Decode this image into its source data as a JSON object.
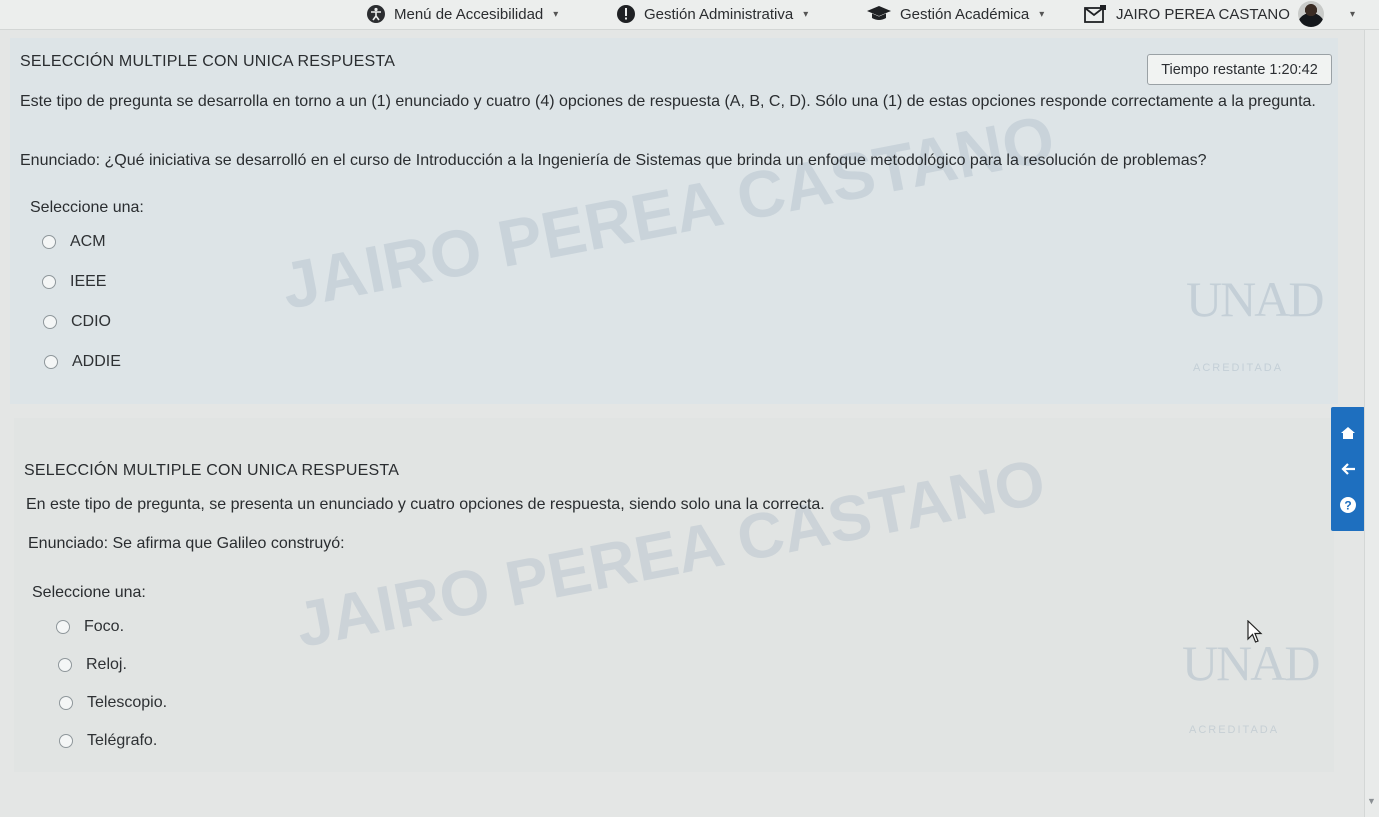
{
  "topbar": {
    "accessibility_menu": "Menú de Accesibilidad",
    "gestion_administrativa": "Gestión Administrativa",
    "gestion_academica": "Gestión Académica",
    "user_name": "JAIRO PEREA CASTANO"
  },
  "question1": {
    "type_heading": "SELECCIÓN MULTIPLE CON UNICA RESPUESTA",
    "timer_label": "Tiempo restante",
    "timer_value": "1:20:42",
    "instructions": "Este tipo de pregunta se desarrolla en torno a un (1) enunciado y cuatro (4) opciones de respuesta (A, B, C, D). Sólo una (1) de estas opciones responde correctamente a la pregunta.",
    "statement": "Enunciado: ¿Qué iniciativa se desarrolló en el curso de Introducción a la Ingeniería de Sistemas que brinda un enfoque metodológico para la resolución de problemas?",
    "prompt": "Seleccione una:",
    "options": [
      "ACM",
      "IEEE",
      "CDIO",
      "ADDIE"
    ]
  },
  "question2": {
    "type_heading": "SELECCIÓN MULTIPLE CON UNICA RESPUESTA",
    "instructions": "En este tipo de pregunta, se presenta un enunciado y cuatro opciones de respuesta, siendo solo una la correcta.",
    "statement": "Enunciado: Se afirma que Galileo construyó:",
    "prompt": "Seleccione una:",
    "options": [
      "Foco.",
      "Reloj.",
      "Telescopio.",
      "Telégrafo."
    ]
  },
  "watermark": {
    "name": "JAIRO PEREA CASTANO",
    "logo_text": "UNAD",
    "accreditation_text": "ACREDITADA"
  },
  "colors": {
    "accent_blue": "#1e6fbf",
    "question_bg": "#dde4e7"
  },
  "icons": {
    "home": "home-icon",
    "back": "arrow-left-icon",
    "help": "question-circle-icon"
  }
}
